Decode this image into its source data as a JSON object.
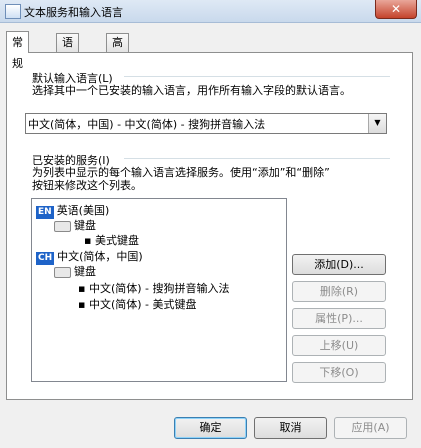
{
  "window": {
    "title": "文本服务和输入语言",
    "close_label": "✕"
  },
  "tabs": [
    {
      "label": "常规"
    },
    {
      "label": "语言栏"
    },
    {
      "label": "高级键设置"
    }
  ],
  "default_language": {
    "group_title": "默认输入语言(L)",
    "description": "选择其中一个已安装的输入语言，用作所有输入字段的默认语言。",
    "selected": "中文(简体，中国) - 中文(简体) - 搜狗拼音输入法"
  },
  "installed_services": {
    "group_title": "已安装的服务(I)",
    "description_line1": "为列表中显示的每个输入语言选择服务。使用“添加”和“删除”",
    "description_line2": "按钮来修改这个列表。",
    "tree": {
      "lang1": {
        "badge": "EN",
        "name": "英语(美国)",
        "keyboard": "键盘",
        "items": [
          "美式键盘"
        ]
      },
      "lang2": {
        "badge": "CH",
        "name": "中文(简体，中国)",
        "keyboard": "键盘",
        "items": [
          "中文(简体) - 搜狗拼音输入法",
          "中文(简体) - 美式键盘"
        ]
      }
    },
    "buttons": {
      "add": "添加(D)...",
      "remove": "删除(R)",
      "properties": "属性(P)...",
      "move_up": "上移(U)",
      "move_down": "下移(O)"
    }
  },
  "footer": {
    "ok": "确定",
    "cancel": "取消",
    "apply": "应用(A)"
  },
  "colors": {
    "lang_badge": "#1e63c8",
    "title_bar": "#dfe9f5"
  }
}
